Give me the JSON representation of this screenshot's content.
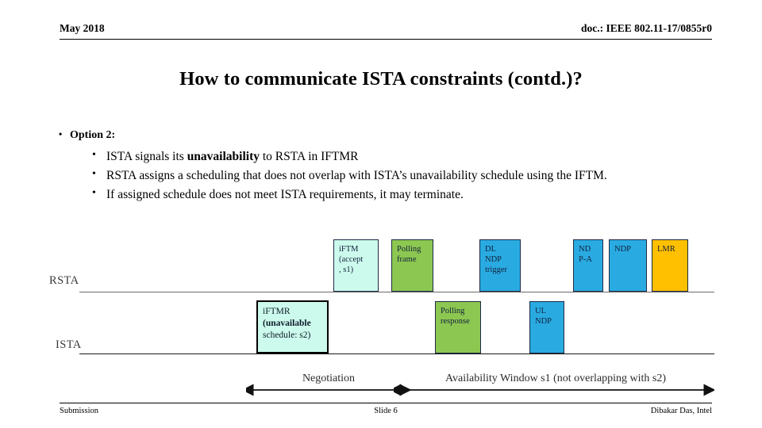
{
  "header": {
    "date": "May 2018",
    "doc": "doc.: IEEE 802.11-17/0855r0"
  },
  "title": "How to communicate ISTA constraints (contd.)?",
  "bullets": {
    "option_label": "Option 2:",
    "sub": [
      {
        "pre": "ISTA signals its ",
        "bold": "unavailability",
        "post": " to RSTA in IFTMR"
      },
      {
        "pre": "RSTA assigns a scheduling that does not overlap with ISTA’s unavailability schedule using the IFTM.",
        "bold": "",
        "post": ""
      },
      {
        "pre": "If assigned schedule does not meet ISTA requirements, it may terminate.",
        "bold": "",
        "post": ""
      }
    ]
  },
  "diagram": {
    "timelines": [
      {
        "name": "RSTA",
        "label": "RSTA"
      },
      {
        "name": "ISTA",
        "label": "ISTA"
      }
    ],
    "colors": {
      "cyan": "#CCFAEC",
      "green": "#8CC751",
      "blue": "#29ABE2",
      "amber": "#FFC000",
      "border": "#1F2A44"
    },
    "rsta_boxes": [
      {
        "name": "iftm-accept-s1",
        "color": "#CCFAEC",
        "lines": [
          "iFTM",
          "(accept",
          ", s1)"
        ],
        "bold": [
          false,
          false,
          false
        ]
      },
      {
        "name": "polling-frame",
        "color": "#8CC751",
        "lines": [
          "Polling",
          "frame"
        ],
        "bold": [
          false,
          false
        ]
      },
      {
        "name": "dl-ndp-trigger",
        "color": "#29ABE2",
        "lines": [
          "DL",
          "NDP",
          "trigger"
        ],
        "bold": [
          false,
          false,
          false
        ]
      },
      {
        "name": "ndp-a",
        "color": "#29ABE2",
        "lines": [
          "ND",
          "P-A"
        ],
        "bold": [
          false,
          false
        ]
      },
      {
        "name": "ndp",
        "color": "#29ABE2",
        "lines": [
          "NDP"
        ],
        "bold": [
          false
        ]
      },
      {
        "name": "lmr",
        "color": "#FFC000",
        "lines": [
          "LMR"
        ],
        "bold": [
          false
        ]
      }
    ],
    "ista_boxes": [
      {
        "name": "iftmr-unavailable-s2",
        "color": "#CCFAEC",
        "lines": [
          "iFTMR",
          "(unavailable",
          "schedule: s2)"
        ],
        "bold": [
          false,
          true,
          false
        ]
      },
      {
        "name": "polling-response",
        "color": "#8CC751",
        "lines": [
          "Polling",
          "response"
        ],
        "bold": [
          false,
          false
        ]
      },
      {
        "name": "ul-ndp",
        "color": "#29ABE2",
        "lines": [
          "UL",
          "NDP"
        ],
        "bold": [
          false,
          false
        ]
      }
    ],
    "spans": [
      {
        "name": "negotiation",
        "label": "Negotiation"
      },
      {
        "name": "availability-window",
        "label": "Availability Window s1 (not overlapping with s2)"
      }
    ]
  },
  "footer": {
    "left": "Submission",
    "center": "Slide 6",
    "right": "Dibakar Das, Intel"
  }
}
